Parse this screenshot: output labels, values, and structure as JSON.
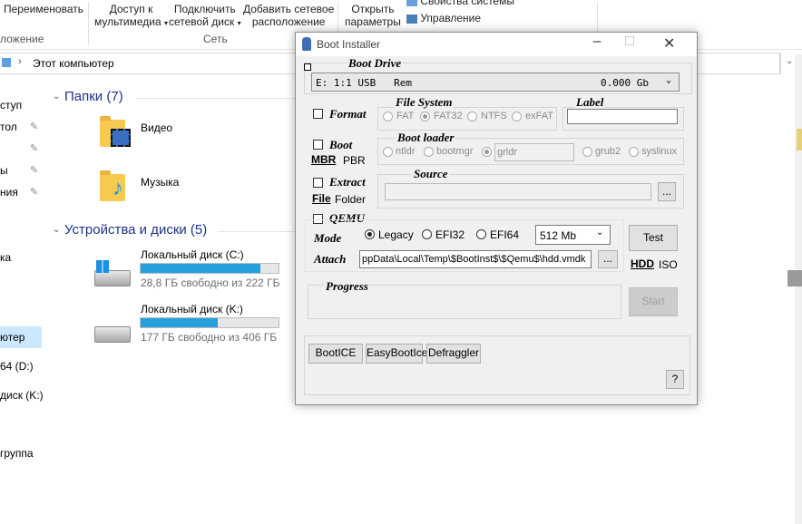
{
  "ribbon": {
    "rename": "Переименовать",
    "left_group": "ложение",
    "media_access_1": "Доступ к",
    "media_access_2": "мультимедиа",
    "map_drive_1": "Подключить",
    "map_drive_2": "сетевой диск",
    "add_location_1": "Добавить сетевое",
    "add_location_2": "расположение",
    "network_group": "Сеть",
    "open_settings_1": "Открыть",
    "open_settings_2": "параметры",
    "system_props": "Свойства системы",
    "manage": "Управление"
  },
  "address": {
    "path": "Этот компьютер"
  },
  "nav": {
    "items": [
      "ступ",
      "тол",
      "ы",
      "ния",
      "ка",
      "ютер",
      "64 (D:)",
      "диск (K:)",
      "группа"
    ]
  },
  "content": {
    "folders_header": "Папки (7)",
    "folders": [
      "Видео",
      "Музыка"
    ],
    "drives_header": "Устройства и диски (5)",
    "drives": [
      {
        "name": "Локальный диск (C:)",
        "free": "28,8 ГБ свободно из 222 ГБ",
        "used_fraction": 0.87
      },
      {
        "name": "Локальный диск (K:)",
        "free": "177 ГБ свободно из 406 ГБ",
        "used_fraction": 0.56
      }
    ]
  },
  "dialog": {
    "title": "Boot Installer",
    "boot_drive_label": "Boot Drive",
    "drive_value": "E: 1:1 USB   Rem",
    "drive_size": "0.000 Gb",
    "format_label": "Format",
    "file_system_label": "File System",
    "fs_options": [
      "FAT",
      "FAT32",
      "NTFS",
      "exFAT"
    ],
    "fs_selected": "FAT32",
    "label_group": "Label",
    "label_value": "",
    "boot_label": "Boot",
    "mbr": "MBR",
    "pbr": "PBR",
    "boot_loader_label": "Boot loader",
    "bl_options": [
      "ntldr",
      "bootmgr",
      "grldr",
      "grub2",
      "syslinux"
    ],
    "bl_selected": "grldr",
    "bl_field": "grldr",
    "extract_label": "Extract",
    "file": "File",
    "folder": "Folder",
    "source_label": "Source",
    "source_value": "",
    "browse": "...",
    "qemu_label": "QEMU",
    "mode_label": "Mode",
    "mode_options": [
      "Legacy",
      "EFI32",
      "EFI64"
    ],
    "mode_selected": "Legacy",
    "memory": "512 Mb",
    "test": "Test",
    "attach_label": "Attach",
    "attach_value": "ppData\\Local\\Temp\\$BootInst$\\$Qemu$\\hdd.vmdk",
    "hdd": "HDD",
    "iso": "ISO",
    "progress_label": "Progress",
    "start": "Start",
    "tools": [
      "BootICE",
      "EasyBootIce",
      "Defraggler"
    ],
    "help": "?"
  }
}
